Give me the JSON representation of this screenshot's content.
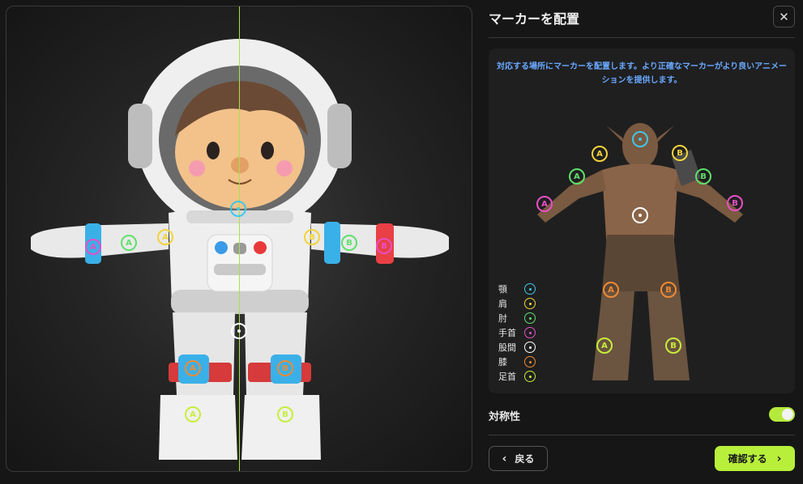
{
  "panel": {
    "title": "マーカーを配置",
    "instruction": "対応する場所にマーカーを配置します。より正確なマーカーがより良いアニメーションを提供します。",
    "legend": [
      {
        "label": "顎",
        "color": "#3fc7e8"
      },
      {
        "label": "肩",
        "color": "#f2d33a"
      },
      {
        "label": "肘",
        "color": "#5fe06a"
      },
      {
        "label": "手首",
        "color": "#e84fc5"
      },
      {
        "label": "股間",
        "color": "#ffffff"
      },
      {
        "label": "膝",
        "color": "#f08a33"
      },
      {
        "label": "足首",
        "color": "#c7ee3a"
      }
    ],
    "symmetry_label": "対称性",
    "symmetry_on": true,
    "back_label": "戻る",
    "confirm_label": "確認する"
  },
  "markers": {
    "a": "A",
    "b": "B"
  },
  "colors": {
    "accent": "#b7ef3a",
    "chin": "#3fc7e8",
    "shoulder": "#f2d33a",
    "elbow": "#5fe06a",
    "wrist": "#e84fc5",
    "crotch": "#ffffff",
    "knee": "#f08a33",
    "ankle": "#c7ee3a"
  },
  "icons": {
    "close": "close-icon",
    "back": "chevron-left-icon",
    "confirm": "chevron-right-icon"
  }
}
